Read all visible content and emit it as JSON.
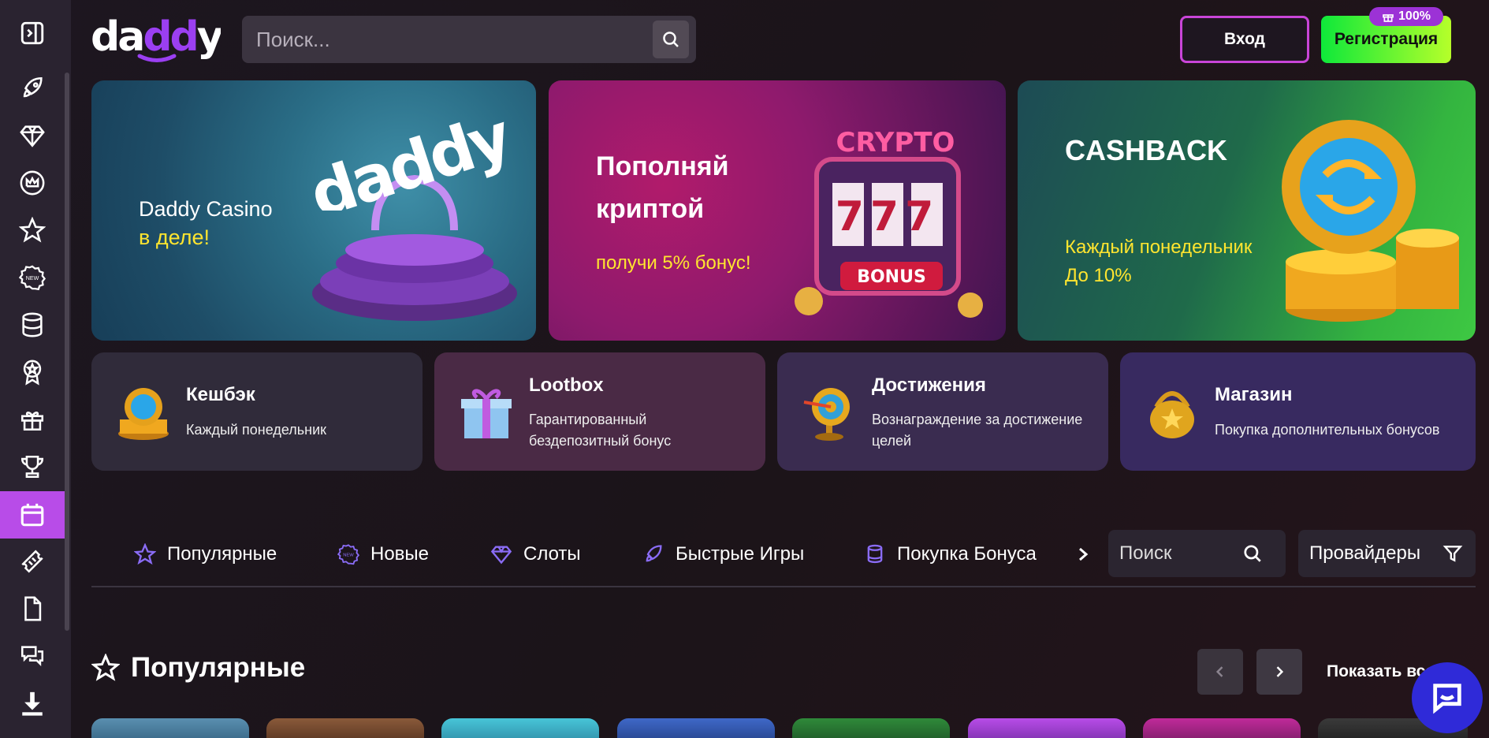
{
  "header": {
    "logo_text": "daddy",
    "search_placeholder": "Поиск...",
    "login_label": "Вход",
    "register_label": "Регистрация",
    "register_badge": "100%"
  },
  "sidebar": {
    "items": [
      {
        "icon": "sidebar-toggle-icon"
      },
      {
        "icon": "rocket-icon"
      },
      {
        "icon": "diamond-icon"
      },
      {
        "icon": "crown-icon"
      },
      {
        "icon": "star-icon"
      },
      {
        "icon": "new-badge-icon",
        "label": "NEW"
      },
      {
        "icon": "database-icon"
      },
      {
        "icon": "award-icon"
      },
      {
        "icon": "gift-icon"
      },
      {
        "icon": "trophy-icon"
      },
      {
        "icon": "calendar-icon",
        "active": true
      },
      {
        "icon": "ticket-icon"
      },
      {
        "icon": "document-icon"
      },
      {
        "icon": "chat-icon"
      },
      {
        "icon": "download-icon"
      }
    ]
  },
  "banners": [
    {
      "line1": "Daddy Casino",
      "line2": "в деле!",
      "logo_text": "daddy"
    },
    {
      "title_line1": "Пополняй",
      "title_line2": "криптой",
      "subtitle": "получи 5% бонус!",
      "art_text1": "CRYPTO",
      "art_text2": "BONUS",
      "art_digits": "777"
    },
    {
      "title": "CASHBACK",
      "line1": "Каждый понедельник",
      "line2": "До 10%"
    }
  ],
  "promo_cards": [
    {
      "title": "Кешбэк",
      "subtitle": "Каждый понедельник"
    },
    {
      "title": "Lootbox",
      "subtitle_line1": "Гарантированный",
      "subtitle_line2": "бездепозитный бонус"
    },
    {
      "title": "Достижения",
      "subtitle_line1": "Вознаграждение за достижение",
      "subtitle_line2": "целей"
    },
    {
      "title": "Магазин",
      "subtitle": "Покупка дополнительных бонусов"
    }
  ],
  "categories": [
    {
      "label": "Популярные",
      "icon": "star-icon"
    },
    {
      "label": "Новые",
      "icon": "new-badge-icon"
    },
    {
      "label": "Слоты",
      "icon": "diamond-icon"
    },
    {
      "label": "Быстрые Игры",
      "icon": "rocket-icon"
    },
    {
      "label": "Покупка Бонуса",
      "icon": "top-hat-icon"
    }
  ],
  "game_search_placeholder": "Поиск",
  "providers_label": "Провайдеры",
  "section": {
    "title": "Популярные",
    "show_all": "Показать все"
  },
  "colors": {
    "accent": "#b84ce8",
    "register_green": "#22f03a",
    "login_border": "#c945d8",
    "yellow_text": "#ffe52f",
    "chat_button": "#2f2ad8"
  }
}
